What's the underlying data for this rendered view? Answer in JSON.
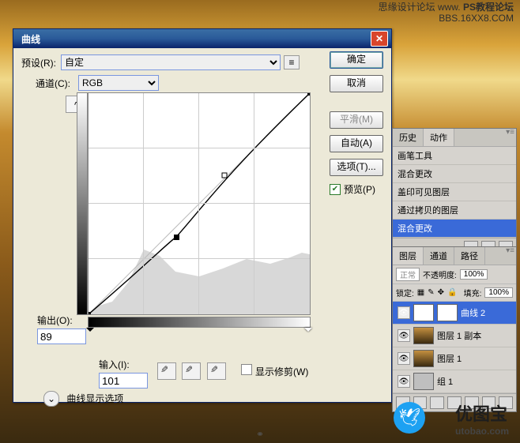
{
  "watermark": {
    "line1": "思缘设计论坛  www.",
    "line2": "PS教程论坛",
    "line3": "BBS.16XX8.COM"
  },
  "dialog": {
    "title": "曲线",
    "preset_label": "预设(R):",
    "preset_value": "自定",
    "channel_label": "通道(C):",
    "channel_value": "RGB",
    "output_label": "输出(O):",
    "output_value": "89",
    "input_label": "输入(I):",
    "input_value": "101",
    "show_clip": "显示修剪(W)",
    "display_opts": "曲线显示选项",
    "buttons": {
      "ok": "确定",
      "cancel": "取消",
      "smooth": "平滑(M)",
      "auto": "自动(A)",
      "options": "选项(T)..."
    },
    "preview": "预览(P)"
  },
  "history_panel": {
    "tabs": [
      "历史",
      "动作"
    ],
    "items": [
      "画笔工具",
      "混合更改",
      "盖印可见图层",
      "通过拷贝的图层",
      "混合更改"
    ]
  },
  "layers_panel": {
    "tabs": [
      "图层",
      "通道",
      "路径"
    ],
    "blend_mode": "正常",
    "opacity_lbl": "不透明度:",
    "opacity": "100%",
    "fill_lbl": "填充:",
    "fill": "100%",
    "lock_lbl": "锁定:",
    "layers": [
      {
        "name": "曲线 2",
        "sel": true,
        "adj": true
      },
      {
        "name": "图层 1 副本"
      },
      {
        "name": "图层 1"
      },
      {
        "name": "组 1",
        "group": true
      }
    ]
  },
  "logo": {
    "cn": "优图宝",
    "en": "utobao.com"
  },
  "chart_data": {
    "type": "line",
    "title": "Curves adjustment",
    "xlabel": "Input",
    "ylabel": "Output",
    "xlim": [
      0,
      255
    ],
    "ylim": [
      0,
      255
    ],
    "points": [
      {
        "x": 0,
        "y": 0
      },
      {
        "x": 101,
        "y": 89
      },
      {
        "x": 157,
        "y": 160
      },
      {
        "x": 255,
        "y": 255
      }
    ],
    "active_point": {
      "x": 101,
      "y": 89
    }
  }
}
